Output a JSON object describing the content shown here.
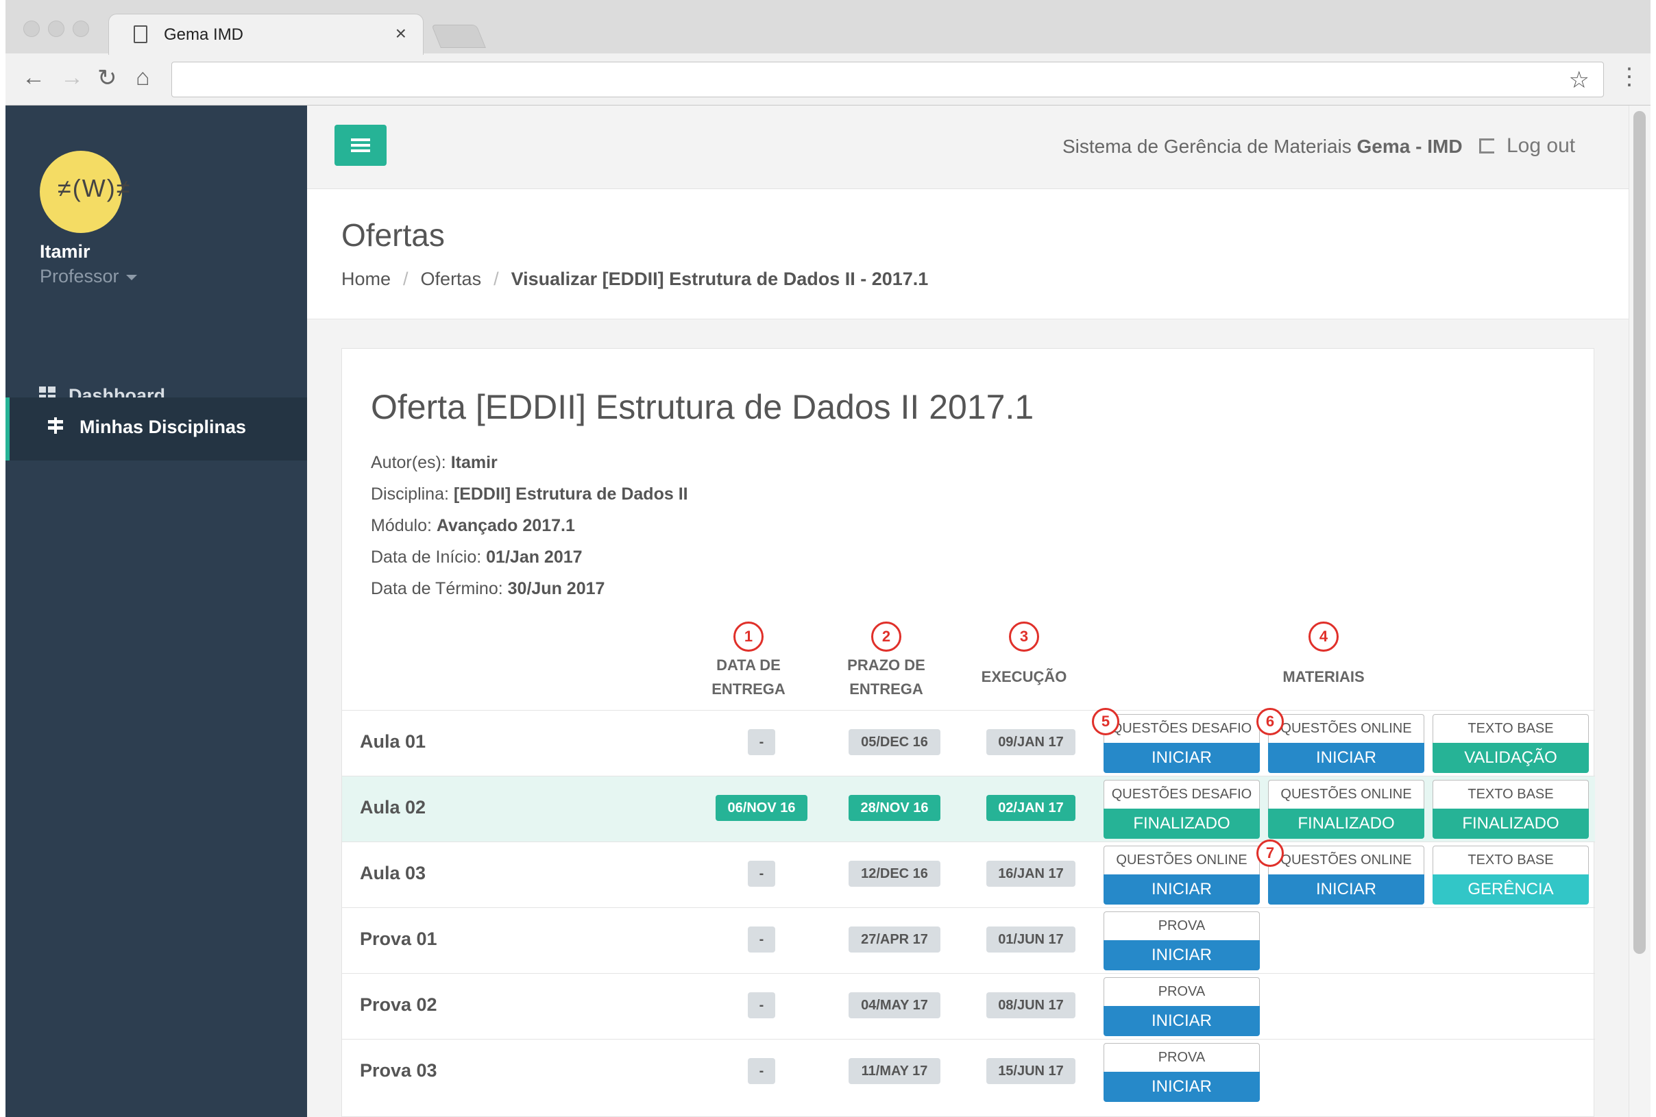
{
  "browser": {
    "tab_title": "Gema IMD",
    "tab_close": "×",
    "back_glyph": "←",
    "forward_glyph": "→",
    "reload_glyph": "↻",
    "home_glyph": "⌂",
    "star_glyph": "☆",
    "menu_glyph": "⋮",
    "address": ""
  },
  "sidebar": {
    "user_name": "Itamir",
    "user_role": "Professor",
    "avatar_face": "≠(W)≠",
    "items": [
      {
        "label": "Dashboard",
        "icon": "dashboard-grid-icon"
      },
      {
        "label": "Minhas Disciplinas",
        "icon": "signpost-icon",
        "active": true
      }
    ]
  },
  "topbar": {
    "system_prefix": "Sistema de Gerência de Materiais ",
    "system_name": "Gema - IMD",
    "logout_label": "Log out"
  },
  "header": {
    "title": "Ofertas",
    "breadcrumb": [
      "Home",
      "Ofertas",
      "Visualizar [EDDII] Estrutura de Dados II - 2017.1"
    ],
    "separator": "/"
  },
  "offer": {
    "title": "Oferta [EDDII] Estrutura de Dados II 2017.1",
    "fields": [
      {
        "label": "Autor(es): ",
        "value": "Itamir"
      },
      {
        "label": "Disciplina: ",
        "value": "[EDDII] Estrutura de Dados II"
      },
      {
        "label": "Módulo: ",
        "value": "Avançado 2017.1"
      },
      {
        "label": "Data de Início: ",
        "value": "01/Jan 2017"
      },
      {
        "label": "Data de Término: ",
        "value": "30/Jun 2017"
      }
    ]
  },
  "table": {
    "headers": {
      "delivery_l1": "DATA DE",
      "delivery_l2": "ENTREGA",
      "deadline_l1": "PRAZO DE",
      "deadline_l2": "ENTREGA",
      "execution": "EXECUÇÃO",
      "materials": "MATERIAIS"
    },
    "markers": [
      "1",
      "2",
      "3",
      "4",
      "5",
      "6",
      "7"
    ],
    "rows": [
      {
        "label": "Aula 01",
        "delivery": "-",
        "deadline": "05/DEC 16",
        "execution": "09/JAN 17",
        "materials": [
          {
            "type": "QUESTÕES DESAFIO",
            "action": "INICIAR",
            "color": "#2689c9"
          },
          {
            "type": "QUESTÕES ONLINE",
            "action": "INICIAR",
            "color": "#2689c9"
          },
          {
            "type": "TEXTO BASE",
            "action": "VALIDAÇÃO",
            "color": "#26b396"
          }
        ]
      },
      {
        "label": "Aula 02",
        "delivery": "06/NOV 16",
        "deadline": "28/NOV 16",
        "execution": "02/JAN 17",
        "highlight": true,
        "materials": [
          {
            "type": "QUESTÕES DESAFIO",
            "action": "FINALIZADO",
            "color": "#26b396"
          },
          {
            "type": "QUESTÕES ONLINE",
            "action": "FINALIZADO",
            "color": "#26b396"
          },
          {
            "type": "TEXTO BASE",
            "action": "FINALIZADO",
            "color": "#26b396"
          }
        ]
      },
      {
        "label": "Aula 03",
        "delivery": "-",
        "deadline": "12/DEC 16",
        "execution": "16/JAN 17",
        "materials": [
          {
            "type": "QUESTÕES ONLINE",
            "action": "INICIAR",
            "color": "#2689c9"
          },
          {
            "type": "QUESTÕES ONLINE",
            "action": "INICIAR",
            "color": "#2689c9"
          },
          {
            "type": "TEXTO BASE",
            "action": "GERÊNCIA",
            "color": "#32c6c7"
          }
        ]
      },
      {
        "label": "Prova 01",
        "delivery": "-",
        "deadline": "27/APR 17",
        "execution": "01/JUN 17",
        "materials": [
          {
            "type": "PROVA",
            "action": "INICIAR",
            "color": "#2689c9"
          }
        ]
      },
      {
        "label": "Prova 02",
        "delivery": "-",
        "deadline": "04/MAY 17",
        "execution": "08/JUN 17",
        "materials": [
          {
            "type": "PROVA",
            "action": "INICIAR",
            "color": "#2689c9"
          }
        ]
      },
      {
        "label": "Prova 03",
        "delivery": "-",
        "deadline": "11/MAY 17",
        "execution": "15/JUN 17",
        "materials": [
          {
            "type": "PROVA",
            "action": "INICIAR",
            "color": "#2689c9"
          }
        ]
      }
    ]
  }
}
